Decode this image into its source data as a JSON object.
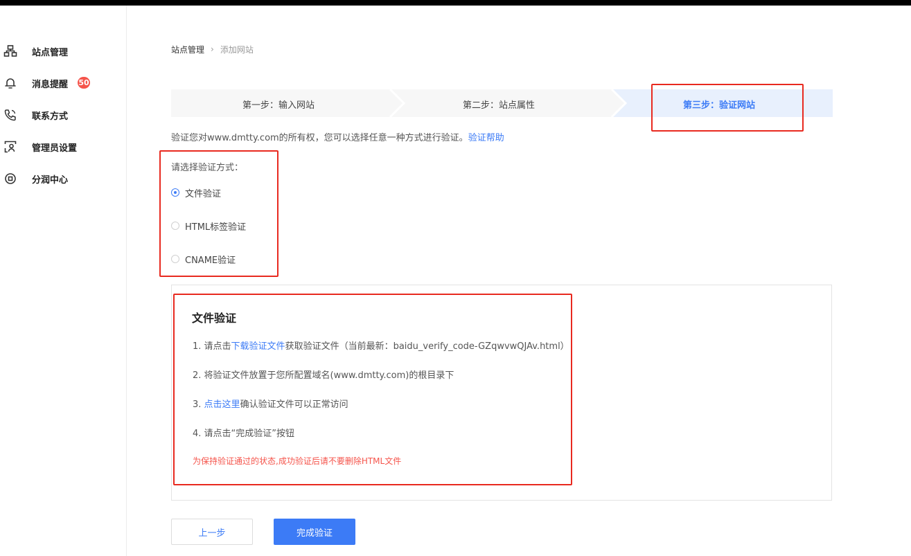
{
  "sidebar": {
    "items": [
      {
        "label": "站点管理",
        "icon": "sitemap-icon"
      },
      {
        "label": "消息提醒",
        "icon": "bell-icon",
        "badge": "50"
      },
      {
        "label": "联系方式",
        "icon": "phone-icon"
      },
      {
        "label": "管理员设置",
        "icon": "admin-user-icon"
      },
      {
        "label": "分润中心",
        "icon": "coin-icon"
      }
    ]
  },
  "breadcrumb": {
    "root": "站点管理",
    "separator": "›",
    "current": "添加网站"
  },
  "steps": [
    {
      "label": "第一步：输入网站",
      "active": false
    },
    {
      "label": "第二步：站点属性",
      "active": false
    },
    {
      "label": "第三步：验证网站",
      "active": true
    }
  ],
  "intro": {
    "text": "验证您对www.dmtty.com的所有权，您可以选择任意一种方式进行验证。",
    "help_link": "验证帮助"
  },
  "methods": {
    "title": "请选择验证方式：",
    "options": [
      {
        "label": "文件验证",
        "checked": true
      },
      {
        "label": "HTML标签验证",
        "checked": false
      },
      {
        "label": "CNAME验证",
        "checked": false
      }
    ]
  },
  "panel": {
    "title": "文件验证",
    "step1_prefix": "1.  请点击",
    "step1_link": "下载验证文件",
    "step1_suffix": "获取验证文件（当前最新：baidu_verify_code-GZqwvwQJAv.html）",
    "step2": "2.  将验证文件放置于您所配置域名(www.dmtty.com)的根目录下",
    "step3_prefix": "3.  ",
    "step3_link": "点击这里",
    "step3_suffix": "确认验证文件可以正常访问",
    "step4": "4.  请点击“完成验证”按钮",
    "warning": "为保持验证通过的状态,成功验证后请不要删除HTML文件"
  },
  "buttons": {
    "prev": "上一步",
    "done": "完成验证"
  },
  "colors": {
    "accent": "#3c7bf6",
    "warning": "#f5544b",
    "highlight": "#e8291f",
    "step_bg": "#f7f7f7",
    "step_active_bg": "#e8f0fd"
  }
}
